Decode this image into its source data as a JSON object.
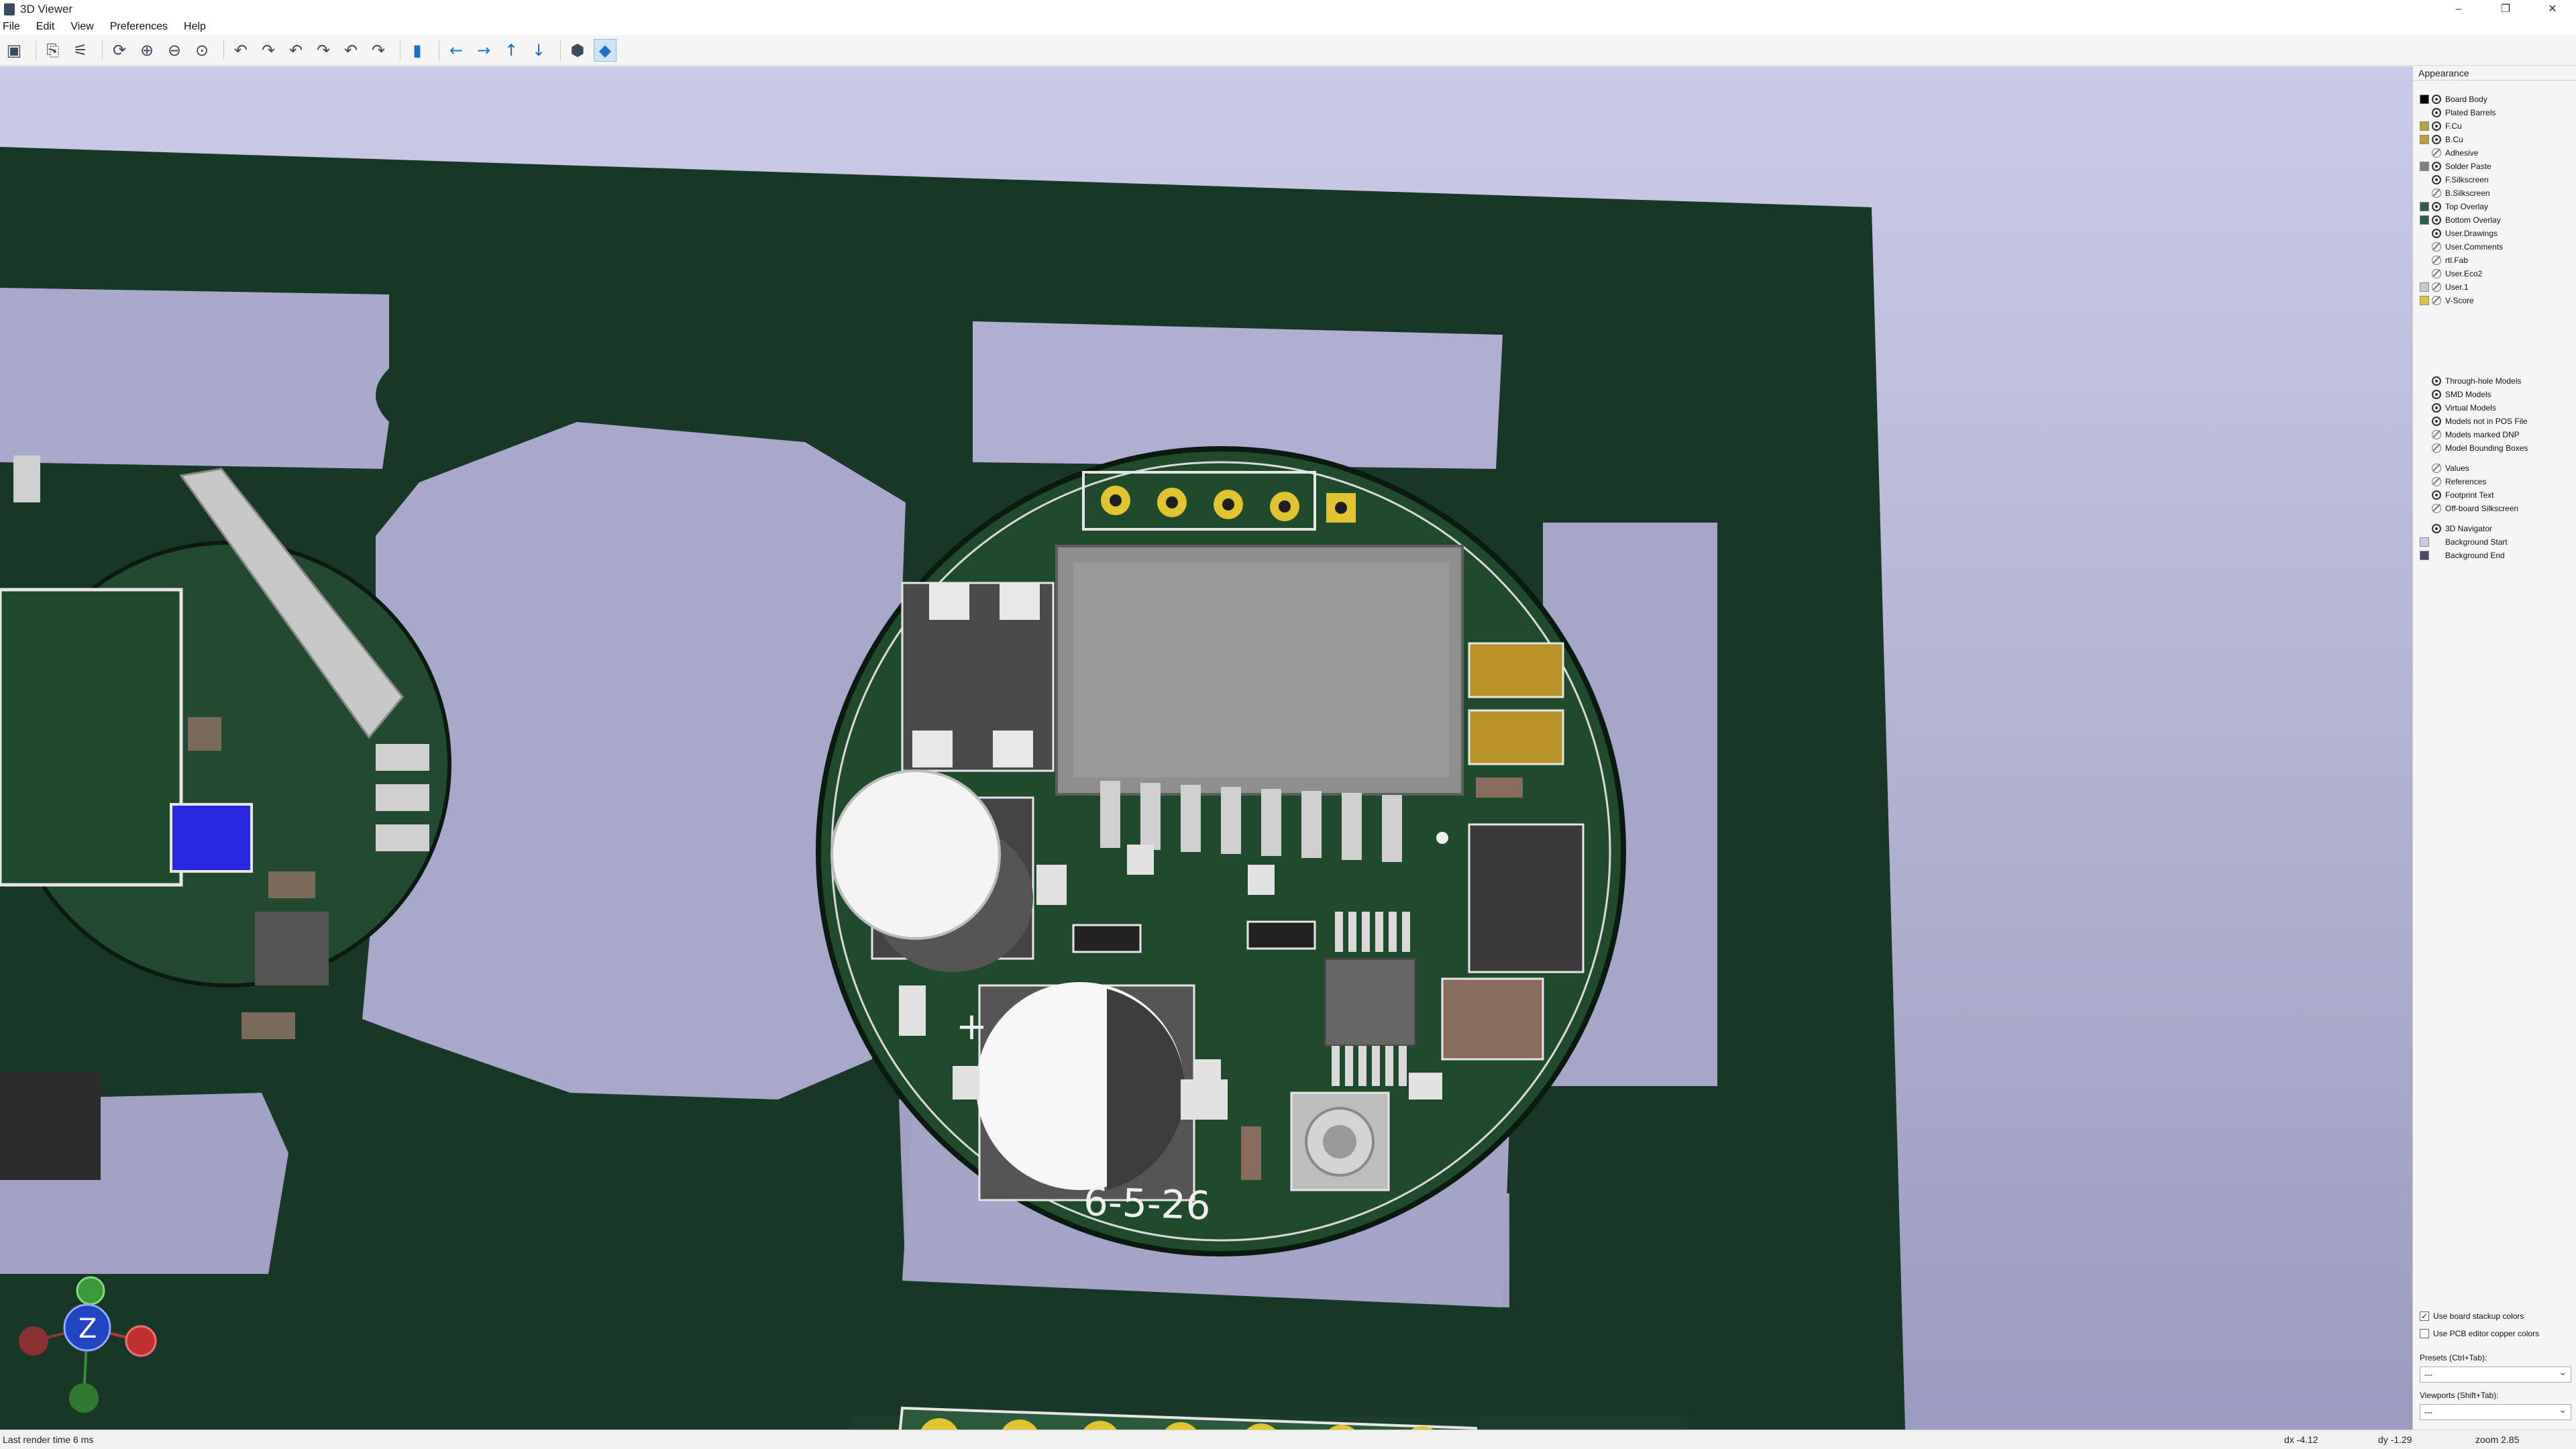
{
  "window": {
    "title": "3D Viewer",
    "min": "–",
    "max": "❐",
    "close": "✕"
  },
  "menu": [
    "File",
    "Edit",
    "View",
    "Preferences",
    "Help"
  ],
  "toolbar": [
    "render-raytrace",
    "copy-clipboard",
    "render-settings",
    "reload",
    "zoom-in",
    "zoom-out",
    "zoom-fit",
    "flip-x",
    "flip-x2",
    "flip-y",
    "flip-y2",
    "flip-z",
    "flip-z2",
    "view-side",
    "move-left",
    "move-right",
    "move-up",
    "move-down",
    "ortho",
    "perspective"
  ],
  "appearance": {
    "title": "Appearance",
    "layers": [
      {
        "label": "Board Body",
        "color": "#000000",
        "eye": "on"
      },
      {
        "label": "Plated Barrels",
        "color": "",
        "eye": "on"
      },
      {
        "label": "F.Cu",
        "color": "#b8a13c",
        "eye": "on"
      },
      {
        "label": "B.Cu",
        "color": "#b8a13c",
        "eye": "on"
      },
      {
        "label": "Adhesive",
        "color": "",
        "eye": "off"
      },
      {
        "label": "Solder Paste",
        "color": "#808080",
        "eye": "on"
      },
      {
        "label": "F.Silkscreen",
        "color": "",
        "eye": "on"
      },
      {
        "label": "B.Silkscreen",
        "color": "",
        "eye": "off"
      },
      {
        "label": "Top Overlay",
        "color": "#2f5a45",
        "eye": "on"
      },
      {
        "label": "Bottom Overlay",
        "color": "#2f5a45",
        "eye": "on"
      },
      {
        "label": "User.Drawings",
        "color": "",
        "eye": "on"
      },
      {
        "label": "User.Comments",
        "color": "",
        "eye": "off"
      },
      {
        "label": "rtl.Fab",
        "color": "",
        "eye": "off"
      },
      {
        "label": "User.Eco2",
        "color": "",
        "eye": "off"
      },
      {
        "label": "User.1",
        "color": "#c8c8c8",
        "eye": "off"
      },
      {
        "label": "V-Score",
        "color": "#d7c545",
        "eye": "off"
      }
    ],
    "models": [
      {
        "label": "Through-hole Models",
        "eye": "on"
      },
      {
        "label": "SMD Models",
        "eye": "on"
      },
      {
        "label": "Virtual Models",
        "eye": "on"
      },
      {
        "label": "Models not in POS File",
        "eye": "on"
      },
      {
        "label": "Models marked DNP",
        "eye": "off"
      },
      {
        "label": "Model Bounding Boxes",
        "eye": "off"
      }
    ],
    "texts": [
      {
        "label": "Values",
        "eye": "off"
      },
      {
        "label": "References",
        "eye": "off"
      },
      {
        "label": "Footprint Text",
        "eye": "on"
      },
      {
        "label": "Off-board Silkscreen",
        "eye": "off"
      }
    ],
    "misc": [
      {
        "label": "3D Navigator",
        "color": "",
        "eye": "on"
      },
      {
        "label": "Background Start",
        "color": "#c9cae6",
        "eye": ""
      },
      {
        "label": "Background End",
        "color": "#4a4b66",
        "eye": ""
      }
    ],
    "use_stackup": "Use board stackup colors",
    "use_pcb_copper": "Use PCB editor copper colors",
    "presets_label": "Presets (Ctrl+Tab):",
    "presets_value": "---",
    "viewports_label": "Viewports (Shift+Tab):",
    "viewports_value": "---"
  },
  "board": {
    "silk_text": "6-5-26",
    "plus": "+",
    "axis_z": "Z"
  },
  "status": {
    "render": "Last render time 6 ms",
    "dx": "dx -4.12",
    "dy": "dy -1.29",
    "zoom": "zoom 2.85"
  }
}
